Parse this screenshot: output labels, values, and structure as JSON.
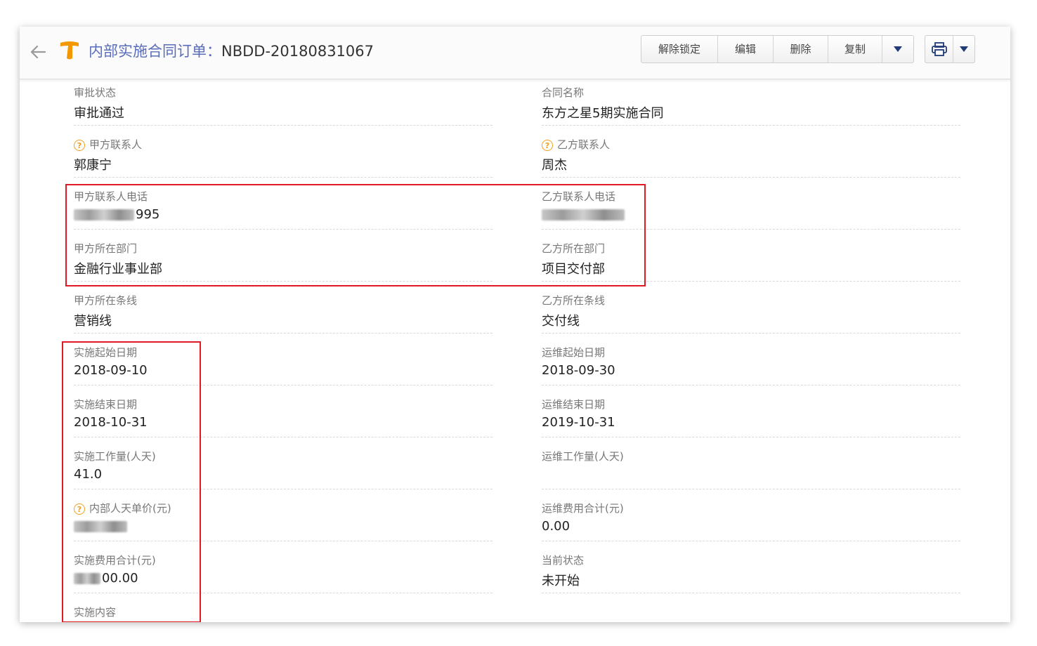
{
  "header": {
    "title_label": "内部实施合同订单：",
    "order_no": "NBDD-20180831067",
    "buttons": {
      "unlock": "解除锁定",
      "edit": "编辑",
      "delete": "删除",
      "copy": "复制"
    }
  },
  "fields": {
    "left": [
      {
        "label": "审批状态",
        "value": "审批通过"
      },
      {
        "label": "甲方联系人",
        "value": "郭康宁",
        "help": true
      },
      {
        "label": "甲方联系人电话",
        "value": "995",
        "masked": true
      },
      {
        "label": "甲方所在部门",
        "value": "金融行业事业部"
      },
      {
        "label": "甲方所在条线",
        "value": "营销线"
      },
      {
        "label": "实施起始日期",
        "value": "2018-09-10"
      },
      {
        "label": "实施结束日期",
        "value": "2018-10-31"
      },
      {
        "label": "实施工作量(人天)",
        "value": "41.0"
      },
      {
        "label": "内部人天单价(元)",
        "value": "",
        "help": true,
        "masked": true
      },
      {
        "label": "实施费用合计(元)",
        "value": "00.00",
        "masked": true
      },
      {
        "label": "实施内容",
        "value": ""
      }
    ],
    "right": [
      {
        "label": "合同名称",
        "value": "东方之星5期实施合同"
      },
      {
        "label": "乙方联系人",
        "value": "周杰",
        "help": true
      },
      {
        "label": "乙方联系人电话",
        "value": "",
        "masked": true
      },
      {
        "label": "乙方所在部门",
        "value": "项目交付部"
      },
      {
        "label": "乙方所在条线",
        "value": "交付线"
      },
      {
        "label": "运维起始日期",
        "value": "2018-09-30"
      },
      {
        "label": "运维结束日期",
        "value": "2019-10-31"
      },
      {
        "label": "运维工作量(人天)",
        "value": ""
      },
      {
        "label": "运维费用合计(元)",
        "value": "0.00"
      },
      {
        "label": "当前状态",
        "value": "未开始"
      }
    ]
  },
  "colors": {
    "highlight": "#e01a22",
    "title_label": "#5a6dbb",
    "help_icon": "#f0a020",
    "logo": "#f39800"
  },
  "icons": [
    "back-arrow-icon",
    "logo-icon",
    "chevron-down-icon",
    "printer-icon",
    "help-icon"
  ]
}
